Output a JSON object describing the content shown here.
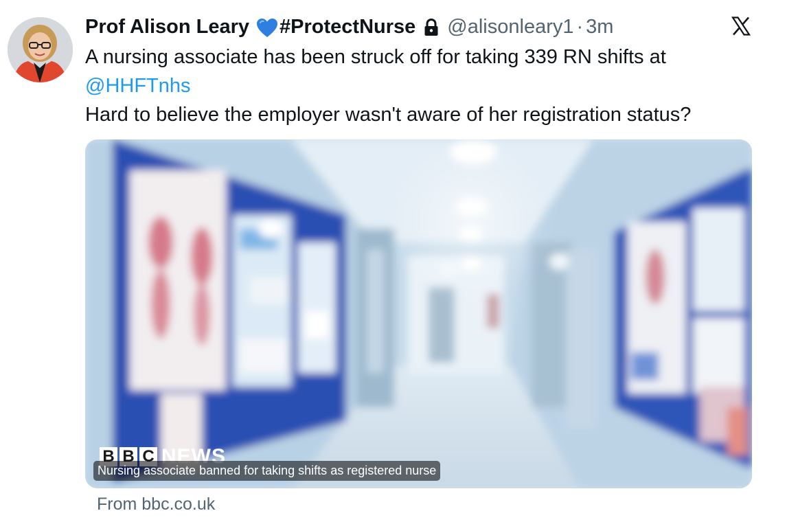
{
  "author": {
    "display_name": "Prof Alison Leary",
    "emoji": "💙",
    "hashtag_name": "#ProtectNurse",
    "handle": "@alisonleary1",
    "separator": "·",
    "time": "3m",
    "locked": true
  },
  "tweet": {
    "line1": "A nursing associate has been struck off for taking 339 RN shifts at",
    "mention": "@HHFTnhs",
    "line3": "Hard to believe the employer wasn't aware of her registration status?"
  },
  "card": {
    "logo_letters": [
      "B",
      "B",
      "C"
    ],
    "logo_word": "NEWS",
    "headline": "Nursing associate banned for taking shifts as registered nurse",
    "source": "From bbc.co.uk"
  },
  "colors": {
    "link": "#1d9bf0",
    "secondary_text": "#536471",
    "primary_text": "#0f1419",
    "heart": "#2f7fe0"
  },
  "icons": {
    "lock": "lock-icon",
    "platform": "x-logo-icon",
    "heart": "blue-heart-icon"
  }
}
